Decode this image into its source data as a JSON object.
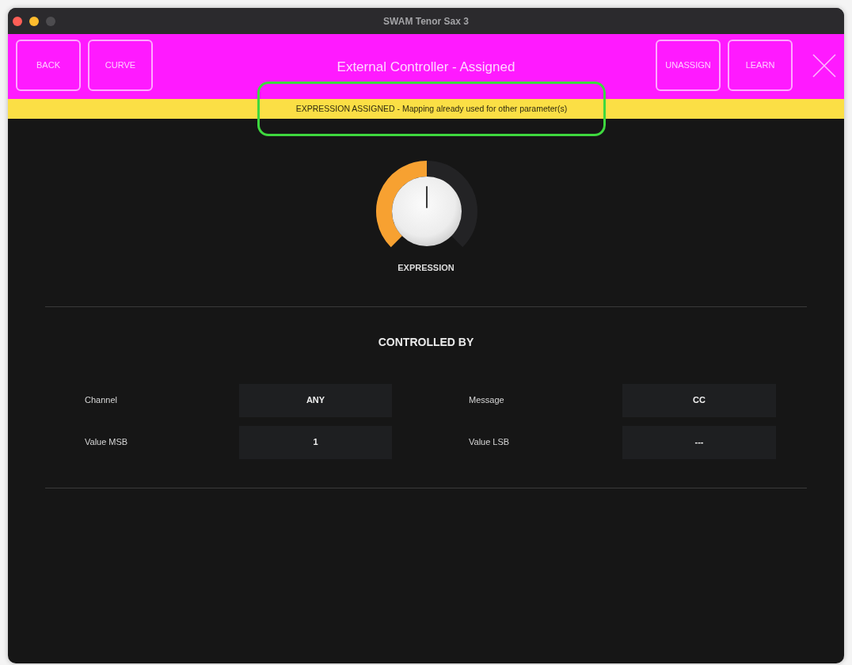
{
  "window": {
    "title": "SWAM Tenor Sax 3",
    "traffic_lights": [
      {
        "kind": "close",
        "disabled": false
      },
      {
        "kind": "minimize",
        "disabled": false
      },
      {
        "kind": "zoom",
        "disabled": true
      }
    ]
  },
  "toolbar": {
    "left_buttons": [
      {
        "label": "BACK"
      },
      {
        "label": "CURVE"
      }
    ],
    "title": "External Controller - Assigned",
    "right_buttons": [
      {
        "label": "UNASSIGN"
      },
      {
        "label": "LEARN"
      }
    ]
  },
  "notice": {
    "text": "EXPRESSION ASSIGNED - Mapping already used for other parameter(s)",
    "highlighted": true
  },
  "knob": {
    "label": "EXPRESSION",
    "level": 0.5
  },
  "controlled_by": {
    "title": "CONTROLLED BY",
    "fields": [
      {
        "label": "Channel",
        "value": "ANY"
      },
      {
        "label": "Message",
        "value": "CC"
      },
      {
        "label": "Value MSB",
        "value": "1"
      },
      {
        "label": "Value LSB",
        "value": "---"
      }
    ]
  }
}
